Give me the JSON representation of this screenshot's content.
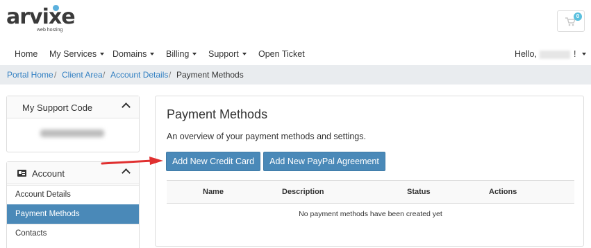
{
  "brand": {
    "logo_text": "arvixe",
    "tagline": "web hosting"
  },
  "cart": {
    "count": "0",
    "icon": "cart-icon"
  },
  "nav": {
    "items": [
      {
        "label": "Home"
      },
      {
        "label": "My Services"
      },
      {
        "label": "Domains"
      },
      {
        "label": "Billing"
      },
      {
        "label": "Support"
      },
      {
        "label": "Open Ticket"
      }
    ],
    "hello_prefix": "Hello,",
    "hello_suffix": "!"
  },
  "breadcrumb": {
    "items": [
      "Portal Home",
      "Client Area",
      "Account Details",
      "Payment Methods"
    ],
    "separator": "/"
  },
  "sidebar": {
    "support_panel": {
      "title": "My Support Code"
    },
    "account_panel": {
      "title": "Account",
      "items": [
        {
          "label": "Account Details"
        },
        {
          "label": "Payment Methods"
        },
        {
          "label": "Contacts"
        }
      ]
    }
  },
  "main": {
    "title": "Payment Methods",
    "description": "An overview of your payment methods and settings.",
    "buttons": {
      "add_credit_card": "Add New Credit Card",
      "add_paypal": "Add New PayPal Agreement"
    },
    "table": {
      "columns": [
        "Name",
        "Description",
        "Status",
        "Actions"
      ],
      "empty_message": "No payment methods have been created yet"
    }
  },
  "colors": {
    "primary": "#4a89b8",
    "link": "#3380c2",
    "annotation_arrow": "#e03030"
  }
}
